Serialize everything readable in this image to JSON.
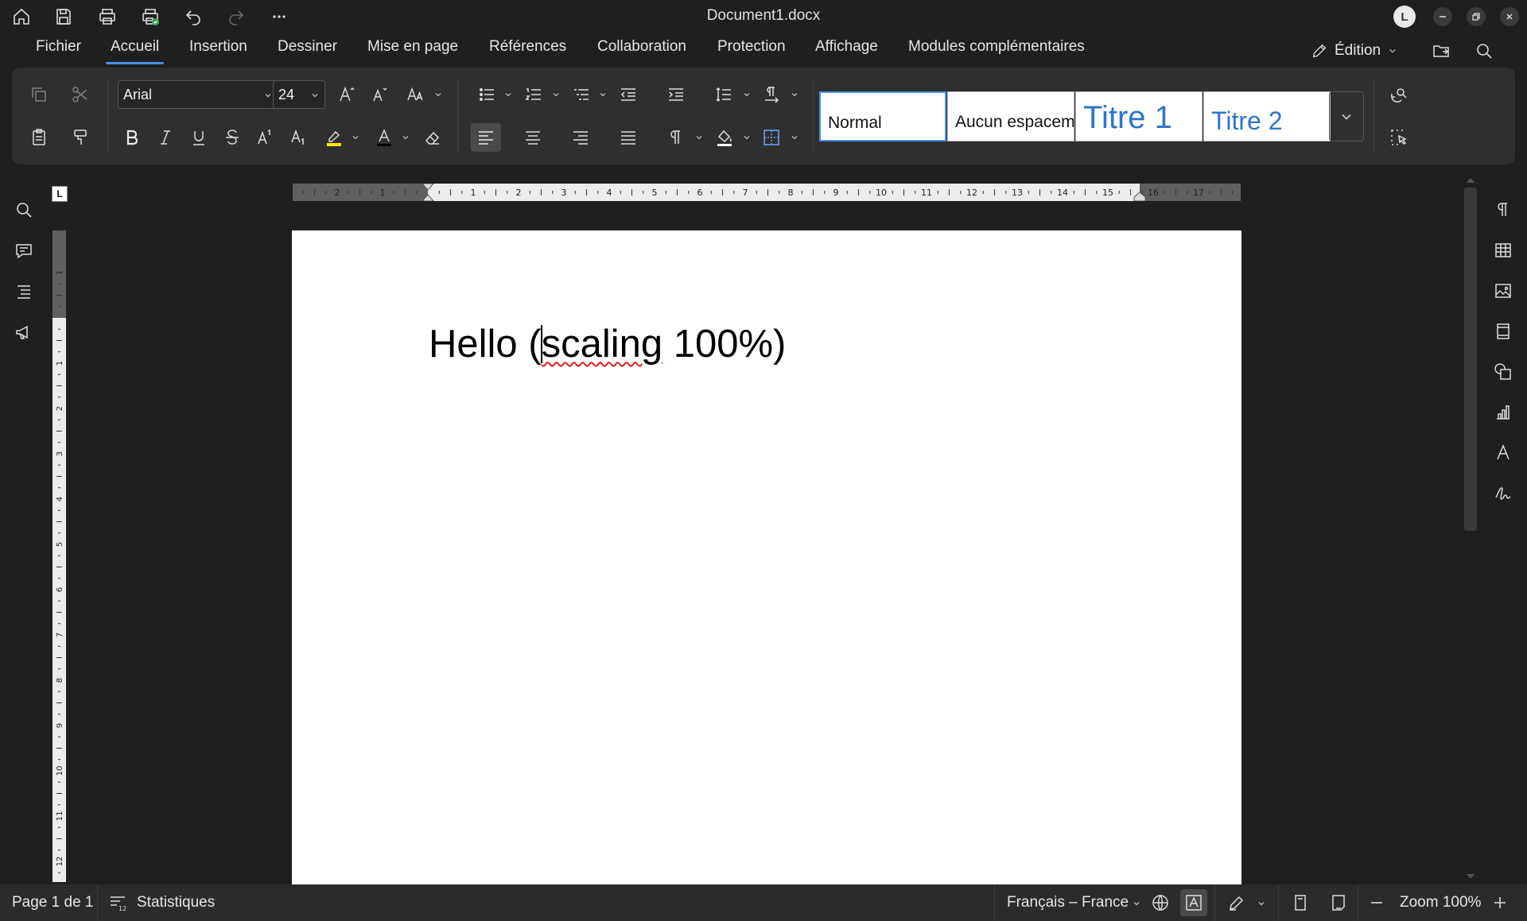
{
  "window": {
    "title": "Document1.docx",
    "avatar_initial": "L"
  },
  "menu": {
    "items": [
      {
        "label": "Fichier"
      },
      {
        "label": "Accueil",
        "active": true
      },
      {
        "label": "Insertion"
      },
      {
        "label": "Dessiner"
      },
      {
        "label": "Mise en page"
      },
      {
        "label": "Références"
      },
      {
        "label": "Collaboration"
      },
      {
        "label": "Protection"
      },
      {
        "label": "Affichage"
      },
      {
        "label": "Modules complémentaires"
      }
    ],
    "mode_label": "Édition"
  },
  "ribbon": {
    "font_name": "Arial",
    "font_size": "24",
    "styles": [
      {
        "label": "Normal",
        "selected": true
      },
      {
        "label": "Aucun espacement"
      },
      {
        "label": "Titre 1"
      },
      {
        "label": "Titre 2"
      }
    ],
    "highlight_color": "#ffe600",
    "font_color": "#000000",
    "accent_color": "#4a8ee8",
    "heading_color": "#2e74c8"
  },
  "ruler": {
    "horizontal_labels": [
      "2",
      "1",
      "1",
      "2",
      "3",
      "4",
      "5",
      "6",
      "7",
      "8",
      "9",
      "10",
      "11",
      "12",
      "13",
      "14",
      "15",
      "16",
      "17"
    ],
    "vertical_labels": [
      "1",
      "1",
      "2",
      "3",
      "4",
      "5",
      "6",
      "7",
      "8",
      "9",
      "10",
      "11",
      "12"
    ],
    "tab_selector": "L"
  },
  "document": {
    "text_before_caret": "Hello (",
    "misspelled_word": "scaling",
    "text_after": " 100%)"
  },
  "status": {
    "page": "Page 1 de 1",
    "statistics": "Statistiques",
    "language": "Français – France",
    "zoom": "Zoom 100%"
  }
}
